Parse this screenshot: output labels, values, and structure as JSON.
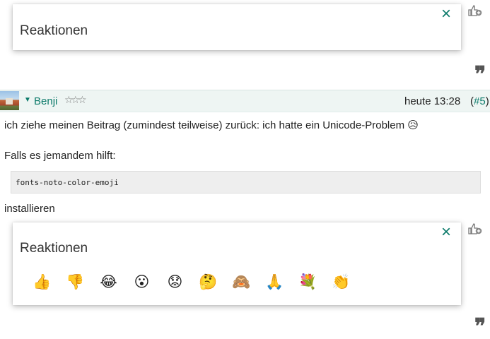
{
  "reaction_popup_top": {
    "title": "Reaktionen",
    "close_icon": "×"
  },
  "post": {
    "author": "Benji",
    "time": "heute 13:28",
    "number_open": "(",
    "number": "#5",
    "number_close": ")",
    "stars": "☆☆☆",
    "text_line1": "ich ziehe meinen Beitrag (zumindest teilweise) zurück: ich hatte ein Unicode-Problem 😥",
    "text_line2": "Falls es jemandem hilft:",
    "code": "fonts-noto-color-emoji",
    "text_line3": "installieren"
  },
  "reaction_popup_bottom": {
    "title": "Reaktionen",
    "close_icon": "×",
    "emojis": [
      "👍",
      "👎",
      "😂",
      "😮",
      "😟",
      "🤔",
      "🙈",
      "🙏",
      "💐",
      "👏"
    ]
  },
  "quote_mark": "❞",
  "colors": {
    "accent": "#0c7a6a",
    "header_bg": "#eef5f3"
  }
}
